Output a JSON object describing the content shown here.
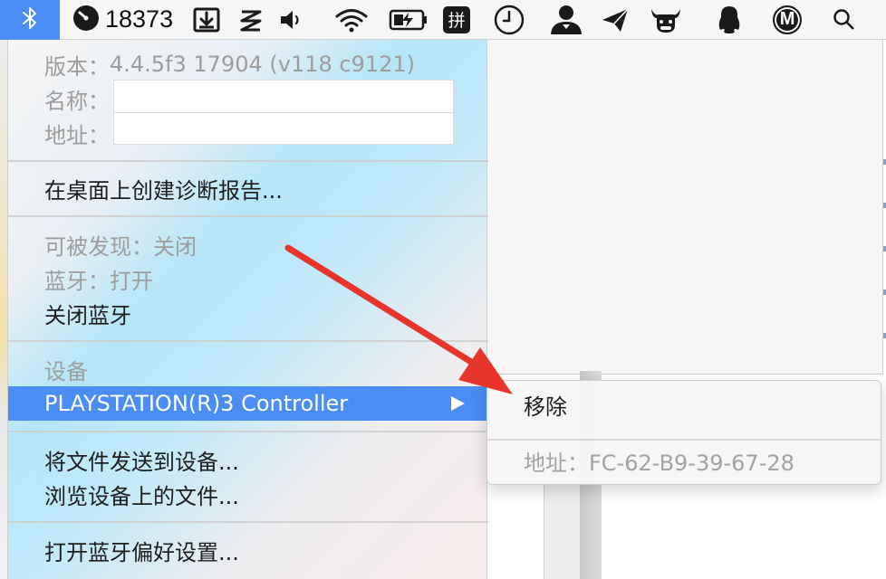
{
  "menubar": {
    "counter": "18373",
    "ime_label": "拼",
    "profile_letter": "M"
  },
  "bt_menu": {
    "version_label": "版本：",
    "version_value": "4.4.5f3 17904 (v118 c9121)",
    "name_label": "名称：",
    "address_label": "地址：",
    "create_report": "在桌面上创建诊断报告...",
    "discoverable": "可被发现：关闭",
    "bluetooth_status": "蓝牙：打开",
    "turn_off": "关闭蓝牙",
    "devices_header": "设备",
    "device_name": "PLAYSTATION(R)3 Controller",
    "send_file": "将文件发送到设备...",
    "browse_files": "浏览设备上的文件...",
    "open_prefs": "打开蓝牙偏好设置..."
  },
  "sub_menu": {
    "remove": "移除",
    "address": "地址：FC-62-B9-39-67-28"
  },
  "colors": {
    "highlight": "#4a8df4",
    "annotation_arrow": "#e8352b"
  }
}
